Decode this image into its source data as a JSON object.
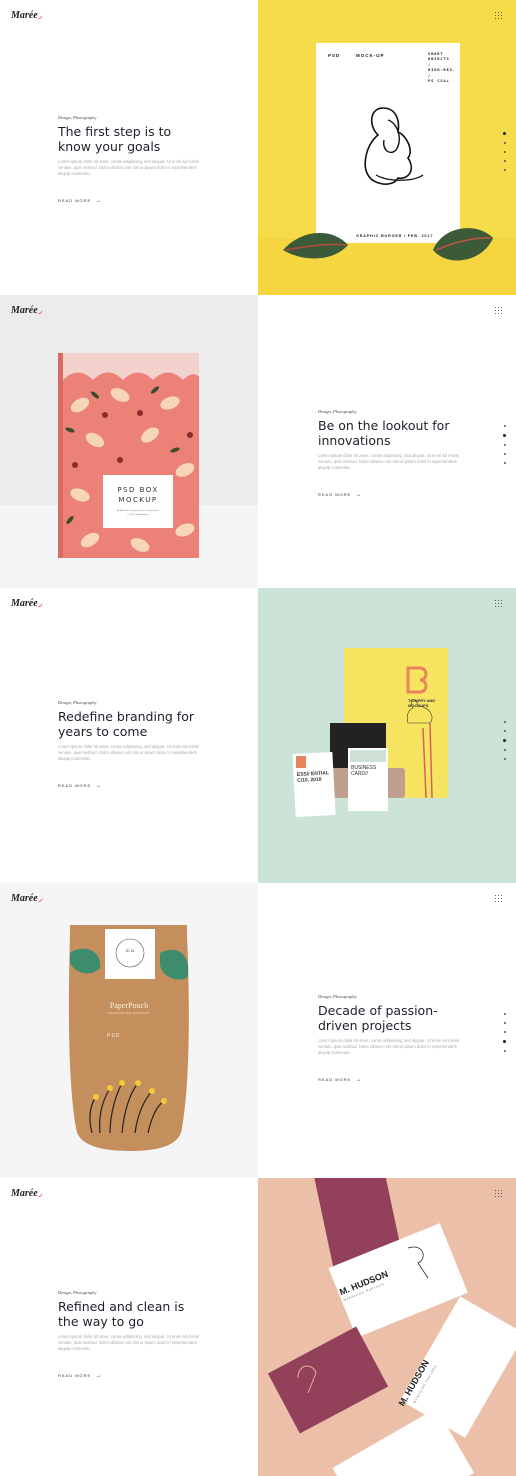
{
  "brand": {
    "logo_text": "Marée",
    "logo_mark": "◞"
  },
  "sections": [
    {
      "category": "Design, Photography",
      "title": "The first step is to know your goals",
      "body": "Lorem ipsum dolor sit amet, conse adipiscing, sed aliquat. Ut enim ad minim veniam, quis nostrud. Dolor ullamco ets nisi ut ipsum dolor in reprehenderit aliquip commodo.",
      "read_more": "READ MORE",
      "mockup": {
        "tag_left": "PSD",
        "tag_center": "MOCK-UP",
        "tag_right_lines": [
          "SMART",
          "OBJECTS",
          "/",
          "HIGH-RES.",
          "/",
          "PS CS4+"
        ],
        "footer": "GRAPHIC BURGER / FEB. 2017"
      },
      "colors": {
        "bg": "#f7dc4a"
      }
    },
    {
      "category": "Design, Photography",
      "title": "Be on the lookout for innovations",
      "body": "Lorem ipsum dolor sit amet, conse adipiscing, sed aliquat. Ut enim ad minim veniam, quis nostrud. Dolor ullamco ets nisi ut ipsum dolor in reprehenderit aliquip commodo.",
      "read_more": "READ MORE",
      "mockup": {
        "line1": "PSD BOX",
        "line2": "MOCKUP",
        "sub1": "An Authentic Design resource by Basil Fairs",
        "sub2": "© 2018 GraphicBurger"
      },
      "colors": {
        "bg": "#ececec"
      }
    },
    {
      "category": "Design, Photography",
      "title": "Redefine branding for years to come",
      "body": "Lorem ipsum dolor sit amet, conse adipiscing, sed aliquat. Ut enim ad minim veniam, quis nostrud. Dolor ullamco ets nisi ut ipsum dolor in reprehenderit aliquip commodo.",
      "read_more": "READ MORE",
      "mockup": {
        "card_text_a": "ESS// ENTIAL C/10. 2018",
        "card_text_b": "BUSINESS CARD//",
        "poster_text": "TIONERY AND MOCKUPS"
      },
      "colors": {
        "bg": "#cce4d7"
      }
    },
    {
      "category": "Design, Photography",
      "title": "Decade of passion-driven projects",
      "body": "Lorem ipsum dolor sit amet, conse adipiscing, sed aliquat. Ut enim ad minim veniam, quis nostrud. Dolor ullamco ets nisi ut ipsum dolor in reprehenderit aliquip commodo.",
      "read_more": "READ MORE",
      "mockup": {
        "title": "PaperPouch",
        "subtitle": "PACKAGING MOCKUP",
        "badge": "20 16",
        "psd": "PSD"
      },
      "colors": {
        "bg": "#f3f3f3"
      }
    },
    {
      "category": "Design, Photography",
      "title": "Refined and clean is the way to go",
      "body": "Lorem ipsum dolor sit amet, conse adipiscing, sed aliquat. Ut enim ad minim veniam, quis nostrud. Dolor ullamco ets nisi ut ipsum dolor in reprehenderit aliquip commodo.",
      "read_more": "READ MORE",
      "mockup": {
        "name": "M. HUDSON",
        "role": "MANAGING PARTNER"
      },
      "colors": {
        "bg": "#ecc0a8"
      }
    }
  ],
  "icons": {
    "menu": "grid-menu-icon",
    "arrow": "arrow-right-icon"
  }
}
